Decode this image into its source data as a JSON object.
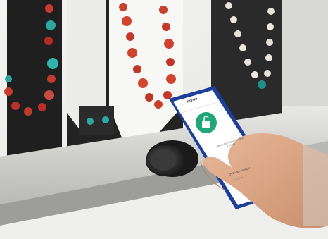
{
  "app": {
    "brand": "invue",
    "status_text": "Secure lock action complete & secure",
    "lock_name": "OVE Lock Manager",
    "lock_subtitle": "Lock Name"
  },
  "colors": {
    "accent_green": "#21a67a",
    "phone_body": "#1c3f9a",
    "lock_knob": "#2b2b2b"
  },
  "icons": [
    "unlock-icon"
  ]
}
